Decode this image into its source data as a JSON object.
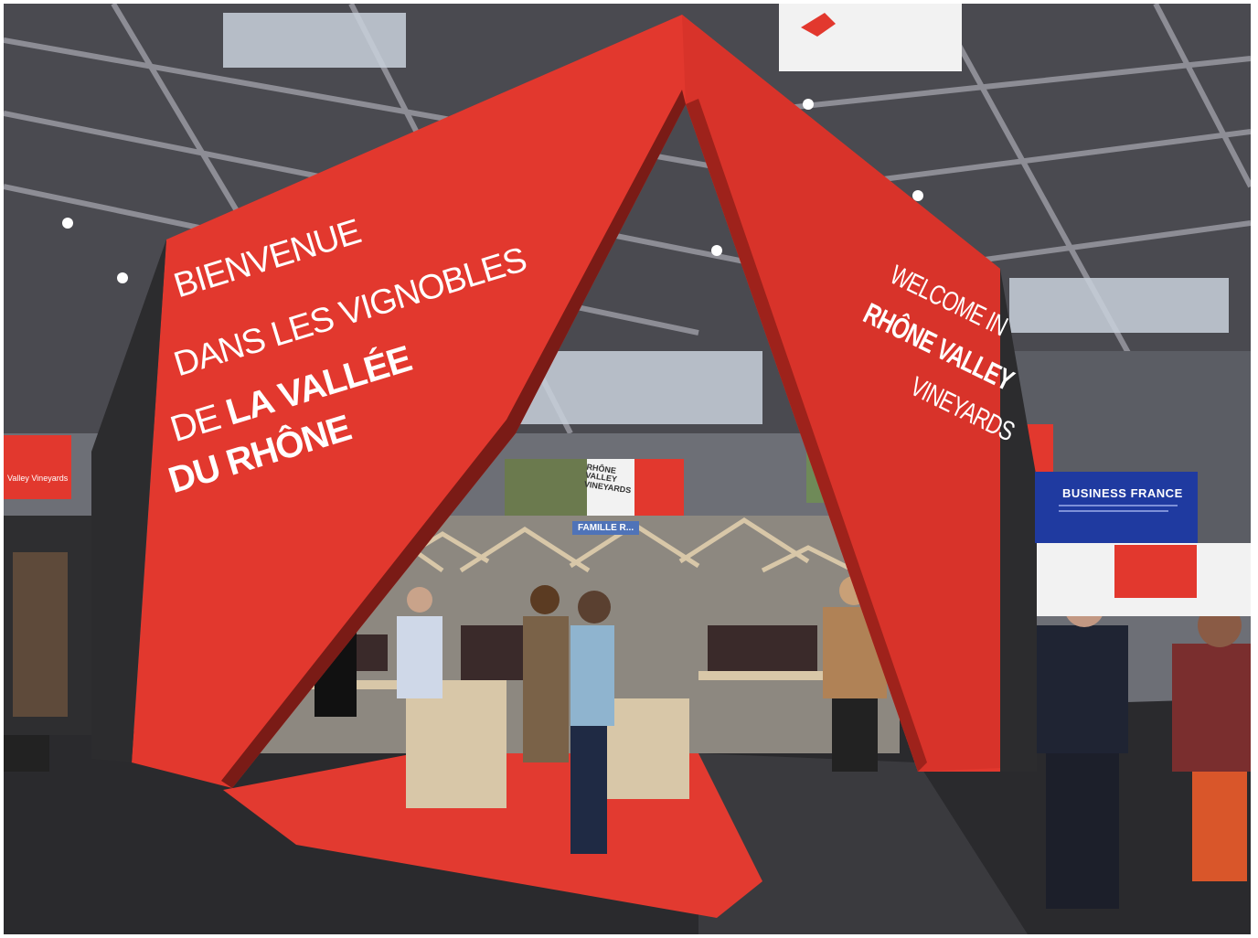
{
  "arch": {
    "left_line1": "BIENVENUE",
    "left_line2": "DANS LES VIGNOBLES",
    "left_line3_prefix": "DE ",
    "left_line3_bold": "LA VALLÉE",
    "left_line4": "DU RHÔNE",
    "right_line1": "WELCOME IN",
    "right_line2": "RHÔNE VALLEY",
    "right_line3": "VINEYARDS"
  },
  "signs": {
    "business_france": "BUSINESS FRANCE",
    "hanging_banner": "RHÔNE\nVALLEY\nVINEYARDS",
    "left_banner": "Valley Vineyards",
    "famille": "FAMILLE R..."
  },
  "colors": {
    "arch_red": "#e2382e",
    "arch_dark": "#b3261f",
    "floor_dark": "#2a2a2d",
    "carpet_red": "#e23a30",
    "ceiling": "#3a3a3e",
    "business_france_blue": "#1f3aa0"
  }
}
